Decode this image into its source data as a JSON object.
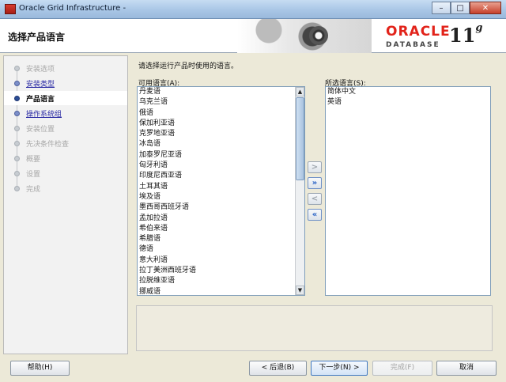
{
  "window": {
    "title": "Oracle Grid Infrastructure -",
    "controls": {
      "minimize": "–",
      "maximize": "□",
      "close": "✕"
    }
  },
  "header": {
    "title": "选择产品语言",
    "logo": {
      "brand": "ORACLE",
      "product": "DATABASE",
      "version": "11",
      "version_suffix": "g"
    }
  },
  "steps": [
    {
      "label": "安装选项",
      "state": "disabled"
    },
    {
      "label": "安装类型",
      "state": "link"
    },
    {
      "label": "产品语言",
      "state": "current"
    },
    {
      "label": "操作系统组",
      "state": "link"
    },
    {
      "label": "安装位置",
      "state": "disabled"
    },
    {
      "label": "先决条件检查",
      "state": "disabled"
    },
    {
      "label": "概要",
      "state": "disabled"
    },
    {
      "label": "设置",
      "state": "disabled"
    },
    {
      "label": "完成",
      "state": "disabled"
    }
  ],
  "main": {
    "prompt": "请选择运行产品时使用的语言。",
    "available_label": "可用语言(A):",
    "selected_label": "所选语言(S):",
    "available": [
      "丹麦语",
      "乌克兰语",
      "俄语",
      "保加利亚语",
      "克罗地亚语",
      "冰岛语",
      "加泰罗尼亚语",
      "匈牙利语",
      "印度尼西亚语",
      "土耳其语",
      "埃及语",
      "墨西哥西班牙语",
      "孟加拉语",
      "希伯来语",
      "希腊语",
      "德语",
      "意大利语",
      "拉丁美洲西班牙语",
      "拉脱维亚语",
      "挪威语"
    ],
    "selected": [
      "简体中文",
      "英语"
    ],
    "move_buttons": {
      "add": ">",
      "add_all": "»",
      "remove": "<",
      "remove_all": "«"
    }
  },
  "footer": {
    "help": "帮助(H)",
    "back": "< 后退(B)",
    "next": "下一步(N) >",
    "finish": "完成(F)",
    "cancel": "取消"
  }
}
